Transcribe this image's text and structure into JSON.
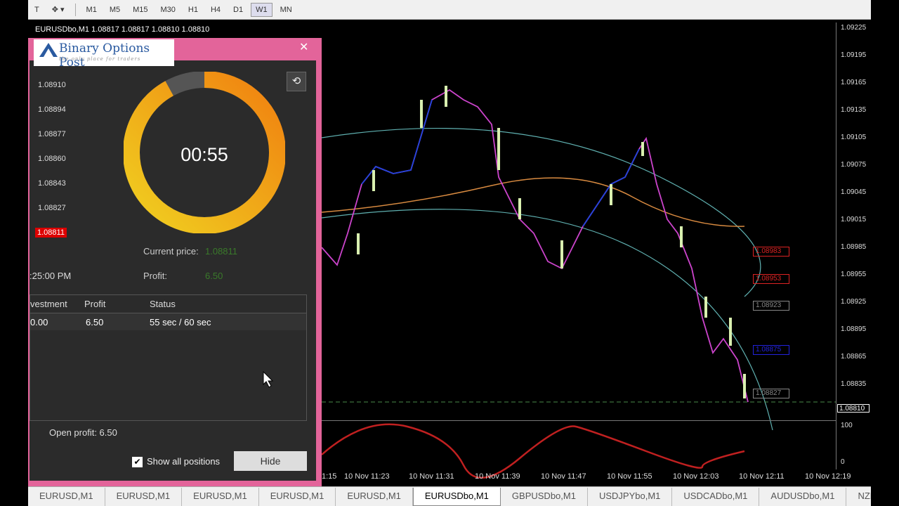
{
  "toolbar": {
    "timeframes": [
      "M1",
      "M5",
      "M15",
      "M30",
      "H1",
      "H4",
      "D1",
      "W1",
      "MN"
    ],
    "active": "W1"
  },
  "chart": {
    "title": "EURUSDbo,M1  1.08817 1.08817 1.08810 1.08810",
    "price_ticks": [
      "1.09225",
      "1.09195",
      "1.09165",
      "1.09135",
      "1.09105",
      "1.09075",
      "1.09045",
      "1.09015",
      "1.08985",
      "1.08955",
      "1.08925",
      "1.08895",
      "1.08865",
      "1.08835"
    ],
    "current_price_tag": "1.08810",
    "level_tags": [
      {
        "text": "1.08983",
        "color": "#d22"
      },
      {
        "text": "1.08953",
        "color": "#d22"
      },
      {
        "text": "1.08923",
        "color": "#888"
      },
      {
        "text": "1.08875",
        "color": "#22d"
      },
      {
        "text": "1.08827",
        "color": "#888"
      }
    ],
    "osc_ticks": [
      "100",
      "0"
    ],
    "time_labels": [
      "1:15",
      "10 Nov 11:23",
      "10 Nov 11:31",
      "10 Nov 11:39",
      "10 Nov 11:47",
      "10 Nov 11:55",
      "10 Nov 12:03",
      "10 Nov 12:11",
      "10 Nov 12:19"
    ]
  },
  "widget": {
    "logo_title": "Binary Options Post",
    "logo_subtitle": "the only place for traders",
    "side_prices": [
      "1.08910",
      "1.08894",
      "1.08877",
      "1.08860",
      "1.08843",
      "1.08827"
    ],
    "side_current": "1.08811",
    "timer": "00:55",
    "timer_progress": 0.92,
    "current_price_label": "Current price:",
    "current_price_value": "1.08811",
    "time_fragment": ":25:00 PM",
    "profit_label": "Profit:",
    "profit_value": "6.50",
    "table": {
      "headers": [
        "vestment",
        "Profit",
        "Status"
      ],
      "rows": [
        [
          "0.00",
          "6.50",
          "55 sec / 60 sec"
        ]
      ]
    },
    "open_profit": "Open profit:  6.50",
    "show_all_label": "Show all positions",
    "hide_label": "Hide"
  },
  "bottom_tabs": [
    "EURUSD,M1",
    "EURUSD,M1",
    "EURUSD,M1",
    "EURUSD,M1",
    "EURUSD,M1",
    "EURUSDbo,M1",
    "GBPUSDbo,M1",
    "USDJPYbo,M1",
    "USDCADbo,M1",
    "AUDUSDbo,M1",
    "NZDUSDb"
  ],
  "active_tab_index": 5
}
